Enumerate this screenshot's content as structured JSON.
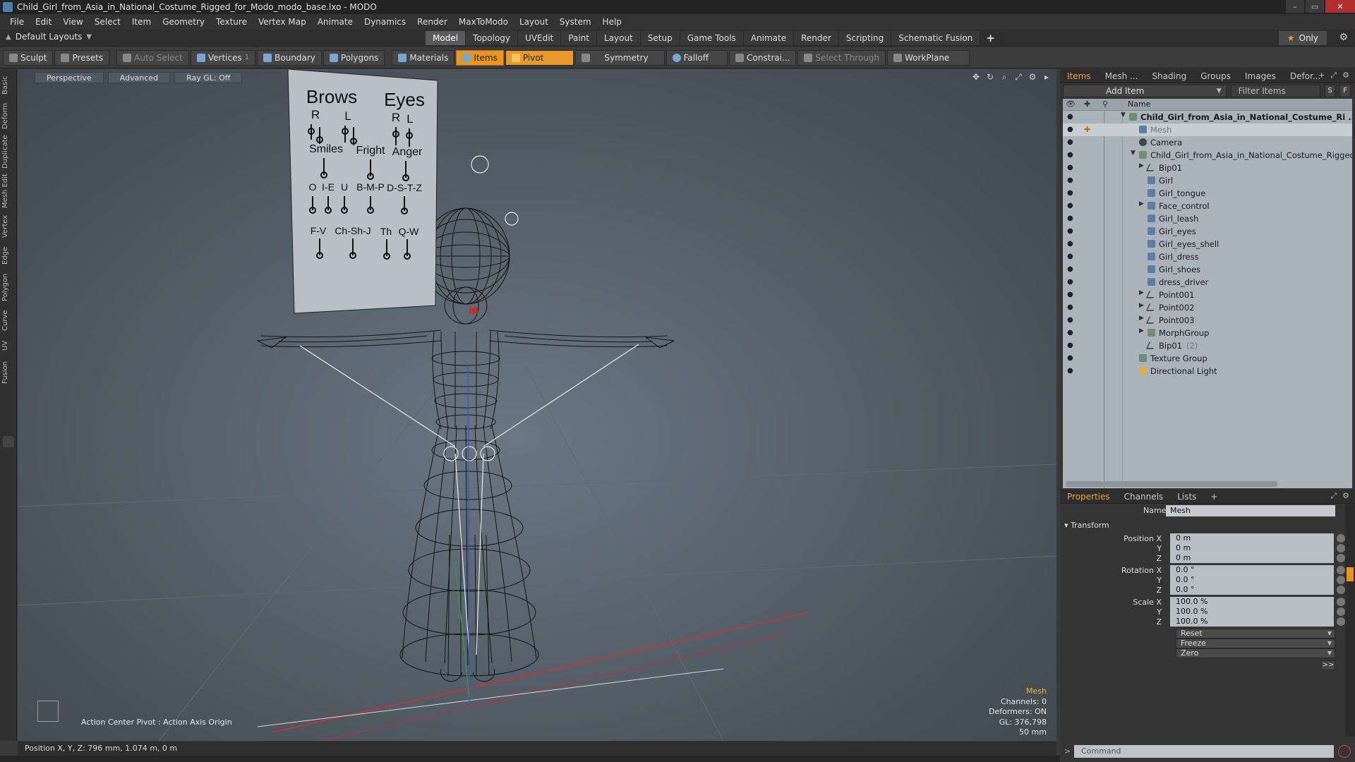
{
  "window": {
    "title": "Child_Girl_from_Asia_in_National_Costume_Rigged_for_Modo_modo_base.lxo - MODO",
    "btn_min": "–",
    "btn_max": "▭",
    "btn_close": "✕"
  },
  "menu": [
    "File",
    "Edit",
    "View",
    "Select",
    "Item",
    "Geometry",
    "Texture",
    "Vertex Map",
    "Animate",
    "Dynamics",
    "Render",
    "MaxToModo",
    "Layout",
    "System",
    "Help"
  ],
  "layout": {
    "default_layouts": "Default Layouts",
    "tabs": [
      "Model",
      "Topology",
      "UVEdit",
      "Paint",
      "Layout",
      "Setup",
      "Game Tools",
      "Animate",
      "Render",
      "Scripting",
      "Schematic Fusion"
    ],
    "active_tab": "Model",
    "plus": "+",
    "only": "Only"
  },
  "toolbar": {
    "sculpt": "Sculpt",
    "presets": "Presets",
    "auto_select": "Auto Select",
    "vertices": "Vertices",
    "vertices_count": "1",
    "boundary": "Boundary",
    "polygons": "Polygons",
    "materials": "Materials",
    "items": "Items",
    "pivot": "Pivot",
    "symmetry": "Symmetry",
    "falloff": "Falloff",
    "constrain": "Constrai...",
    "select_through": "Select Through",
    "workplane": "WorkPlane"
  },
  "left_tabs": [
    "Basic",
    "Deform",
    "Duplicate",
    "Mesh Edit",
    "Vertex",
    "Edge",
    "Polygon",
    "Curve",
    "UV",
    "Fusion"
  ],
  "viewport": {
    "perspective": "Perspective",
    "advanced": "Advanced",
    "raygl": "Ray GL: Off",
    "action_center": "Action Center Pivot : Action Axis Origin",
    "info": {
      "item": "Mesh",
      "channels": "Channels: 0",
      "deformers": "Deformers: ON",
      "gl": "GL: 376,798",
      "lens": "50 mm"
    },
    "board": {
      "brows": "Brows",
      "eyes": "Eyes",
      "r1": "R",
      "l1": "L",
      "r2": "R",
      "l2": "L",
      "smiles": "Smiles",
      "fright": "Fright",
      "anger": "Anger",
      "o": "O",
      "ie": "I-E",
      "u": "U",
      "bmp": "B-M-P",
      "dstz": "D-S-T-Z",
      "fv": "F-V",
      "chshj": "Ch-Sh-J",
      "th": "Th",
      "qw": "Q-W"
    }
  },
  "status": {
    "position": "Position X, Y, Z:   796 mm, 1.074 m, 0 m"
  },
  "items_panel": {
    "tabs": [
      "Items",
      "Mesh ...",
      "Shading",
      "Groups",
      "Images",
      "Defor..."
    ],
    "plus": "+",
    "add_item": "Add Item",
    "filter": "Filter Items",
    "s": "S",
    "f": "F",
    "column_name": "Name",
    "rows": [
      {
        "label": "Child_Girl_from_Asia_in_National_Costume_Ri ...",
        "indent": 0,
        "bold": true
      },
      {
        "label": "Mesh",
        "indent": 1,
        "dim": true,
        "selected": true
      },
      {
        "label": "Camera",
        "indent": 1
      },
      {
        "label": "Child_Girl_from_Asia_in_National_Costume_Rigged",
        "indent": 1
      },
      {
        "label": "Bip01",
        "indent": 2
      },
      {
        "label": "Girl",
        "indent": 2
      },
      {
        "label": "Girl_tongue",
        "indent": 2
      },
      {
        "label": "Face_control",
        "indent": 2
      },
      {
        "label": "Girl_leash",
        "indent": 2
      },
      {
        "label": "Girl_eyes",
        "indent": 2
      },
      {
        "label": "Girl_eyes_shell",
        "indent": 2
      },
      {
        "label": "Girl_dress",
        "indent": 2
      },
      {
        "label": "Girl_shoes",
        "indent": 2
      },
      {
        "label": "dress_driver",
        "indent": 2
      },
      {
        "label": "Point001",
        "indent": 2
      },
      {
        "label": "Point002",
        "indent": 2
      },
      {
        "label": "Point003",
        "indent": 2
      },
      {
        "label": "MorphGroup",
        "indent": 2
      },
      {
        "label": "Bip01",
        "suffix": "(2)",
        "indent": 2
      },
      {
        "label": "Texture Group",
        "indent": 1
      },
      {
        "label": "Directional Light",
        "indent": 1
      }
    ]
  },
  "properties": {
    "tabs": [
      "Properties",
      "Channels",
      "Lists"
    ],
    "plus": "+",
    "name_label": "Name",
    "name_value": "Mesh",
    "transform": "Transform",
    "position_label": "Position X",
    "rotation_label": "Rotation X",
    "scale_label": "Scale X",
    "y": "Y",
    "z": "Z",
    "pos": [
      "0 m",
      "0 m",
      "0 m"
    ],
    "rot": [
      "0.0 °",
      "0.0 °",
      "0.0 °"
    ],
    "scale": [
      "100.0 %",
      "100.0 %",
      "100.0 %"
    ],
    "reset": "Reset",
    "freeze": "Freeze",
    "zero": "Zero",
    "more": ">>",
    "command_placeholder": "Command"
  }
}
